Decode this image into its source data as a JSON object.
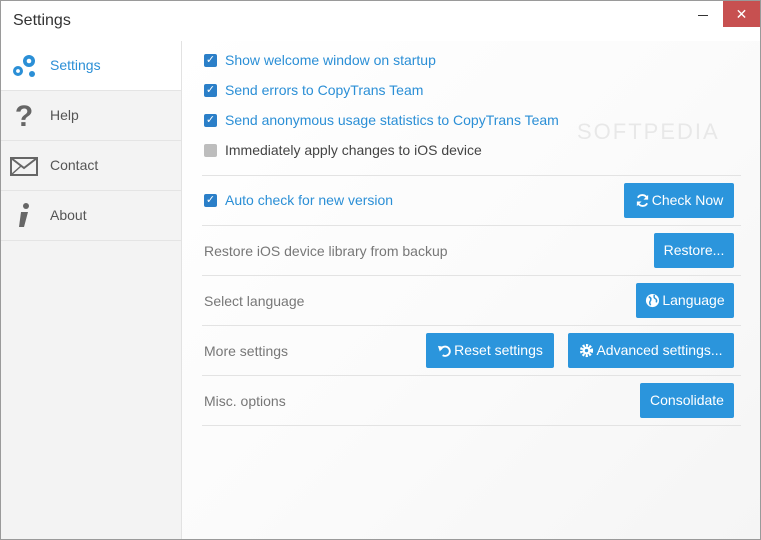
{
  "window": {
    "title": "Settings",
    "close_glyph": "✕"
  },
  "sidebar": {
    "items": [
      {
        "label": "Settings",
        "icon": "gears-icon",
        "active": true
      },
      {
        "label": "Help",
        "icon": "question-icon",
        "active": false
      },
      {
        "label": "Contact",
        "icon": "envelope-icon",
        "active": false
      },
      {
        "label": "About",
        "icon": "info-icon",
        "active": false
      }
    ]
  },
  "options": {
    "show_welcome": {
      "label": "Show welcome window on startup",
      "checked": true
    },
    "send_errors": {
      "label": "Send errors to CopyTrans Team",
      "checked": true
    },
    "send_stats": {
      "label": "Send anonymous usage statistics to CopyTrans Team",
      "checked": true
    },
    "apply_changes": {
      "label": "Immediately apply changes to iOS device",
      "checked": false
    },
    "auto_check": {
      "label": "Auto check for new version",
      "checked": true
    }
  },
  "rows": {
    "restore": {
      "label": "Restore iOS device library from backup",
      "button": "Restore..."
    },
    "language": {
      "label": "Select language",
      "button": "Language"
    },
    "more": {
      "label": "More settings",
      "reset_button": "Reset settings",
      "advanced_button": "Advanced settings..."
    },
    "misc": {
      "label": "Misc. options",
      "button": "Consolidate"
    },
    "check_now_button": "Check Now"
  },
  "watermark": "SOFTPEDIA",
  "colors": {
    "accent": "#2b95dc",
    "link_text": "#2b8fd6",
    "checkbox": "#2b7fc8"
  }
}
